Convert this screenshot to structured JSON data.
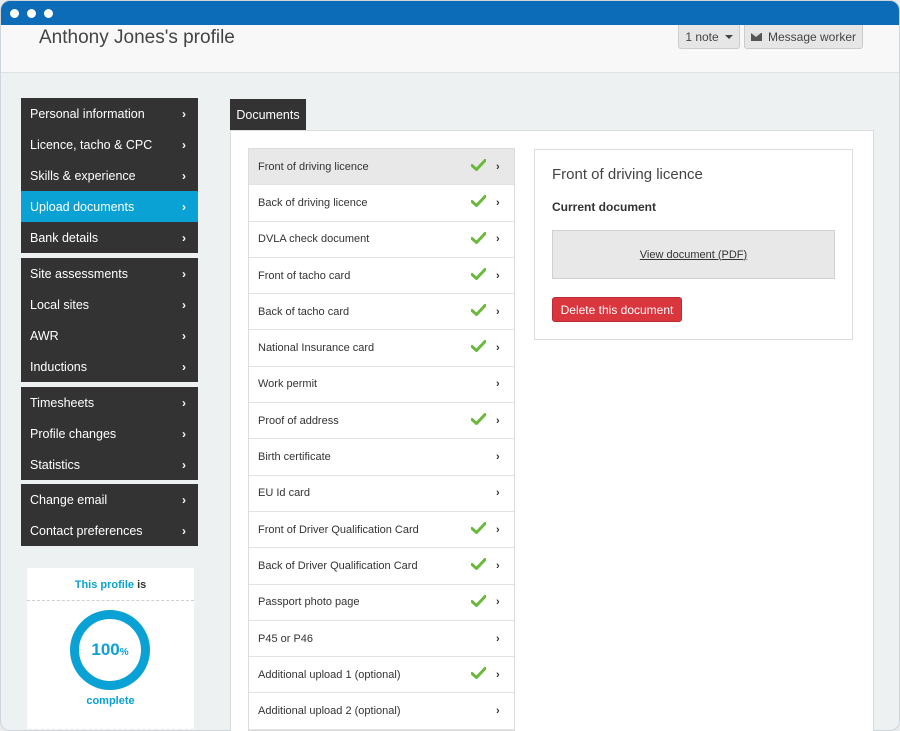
{
  "header": {
    "title": "Anthony Jones's profile",
    "note_label": "1 note",
    "message_label": "Message worker"
  },
  "sidebar": {
    "groups": [
      [
        "Personal information",
        "Licence, tacho & CPC",
        "Skills & experience",
        "Upload documents",
        "Bank details"
      ],
      [
        "Site assessments",
        "Local sites",
        "AWR",
        "Inductions"
      ],
      [
        "Timesheets",
        "Profile changes",
        "Statistics"
      ],
      [
        "Change email",
        "Contact preferences"
      ]
    ],
    "active": "Upload documents"
  },
  "profile_progress": {
    "prefix": "This profile",
    "suffix": " is",
    "percent": "100",
    "unit": "%",
    "label": "complete",
    "value": 1.0
  },
  "documents": {
    "tab_label": "Documents",
    "items": [
      {
        "label": "Front of driving licence",
        "uploaded": true
      },
      {
        "label": "Back of driving licence",
        "uploaded": true
      },
      {
        "label": "DVLA check document",
        "uploaded": true
      },
      {
        "label": "Front of tacho card",
        "uploaded": true
      },
      {
        "label": "Back of tacho card",
        "uploaded": true
      },
      {
        "label": "National Insurance card",
        "uploaded": true
      },
      {
        "label": "Work permit",
        "uploaded": false
      },
      {
        "label": "Proof of address",
        "uploaded": true
      },
      {
        "label": "Birth certificate",
        "uploaded": false
      },
      {
        "label": "EU Id card",
        "uploaded": false
      },
      {
        "label": "Front of Driver Qualification Card",
        "uploaded": true
      },
      {
        "label": "Back of Driver Qualification Card",
        "uploaded": true
      },
      {
        "label": "Passport photo page",
        "uploaded": true
      },
      {
        "label": "P45 or P46",
        "uploaded": false
      },
      {
        "label": "Additional upload 1 (optional)",
        "uploaded": true
      },
      {
        "label": "Additional upload 2 (optional)",
        "uploaded": false
      }
    ],
    "selected": 0
  },
  "detail": {
    "title": "Front of driving licence",
    "subtitle": "Current document",
    "view_label": "View document (PDF)",
    "delete_label": "Delete this document"
  },
  "colors": {
    "titlebar": "#0d6cb8",
    "accent": "#0aa1d4",
    "sidebar": "#333333",
    "check": "#6ab93b",
    "danger": "#d9363e"
  }
}
